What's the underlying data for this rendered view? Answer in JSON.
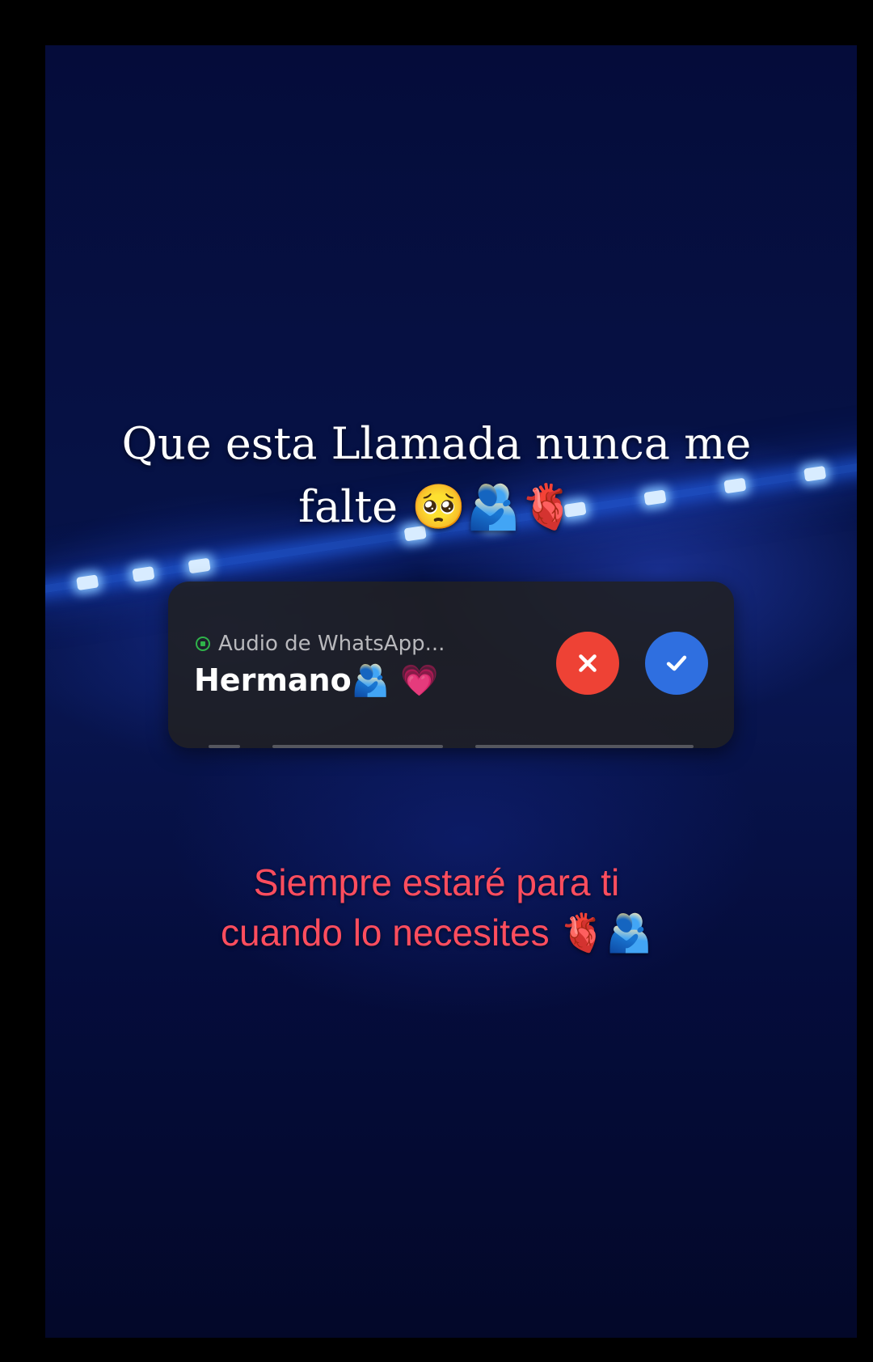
{
  "caption_top": {
    "line1": "Que esta  Llamada nunca me",
    "line2": "falte 🥺🫂🫀"
  },
  "notification": {
    "app_label": "Audio de WhatsApp...",
    "caller_name": "Hermano🫂 💗",
    "app_icon": "whatsapp-icon",
    "decline_icon": "close-icon",
    "accept_icon": "check-icon",
    "decline_color": "#ee4235",
    "accept_color": "#2f6fe0"
  },
  "caption_bottom": {
    "line1": "Siempre estaré para ti",
    "line2": "cuando lo necesites 🫀🫂"
  },
  "colors": {
    "background": "#061246",
    "caption_bottom": "#ff4d5e",
    "led_glow": "#2866ff"
  }
}
